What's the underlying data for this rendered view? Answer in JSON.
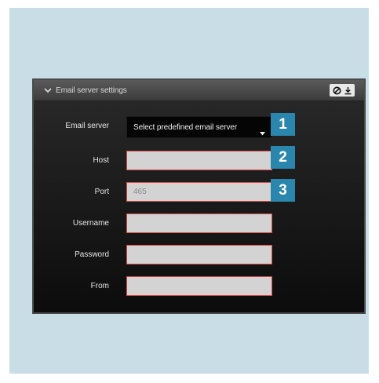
{
  "panel": {
    "title": "Email server settings",
    "icons": {
      "collapse": "chevron-down-icon",
      "clear": "clear-icon",
      "download": "download-icon"
    }
  },
  "form": {
    "email_server": {
      "label": "Email server",
      "value": "Select predefined email server"
    },
    "host": {
      "label": "Host",
      "value": ""
    },
    "port": {
      "label": "Port",
      "value": "",
      "placeholder": "465"
    },
    "username": {
      "label": "Username",
      "value": ""
    },
    "password": {
      "label": "Password",
      "value": ""
    },
    "from": {
      "label": "From",
      "value": ""
    }
  },
  "callouts": [
    "1",
    "2",
    "3"
  ],
  "colors": {
    "canvas": "#c9dde7",
    "badge": "#2b86ad",
    "field_border": "#d84a4a",
    "field_bg": "#d3d3d3"
  }
}
